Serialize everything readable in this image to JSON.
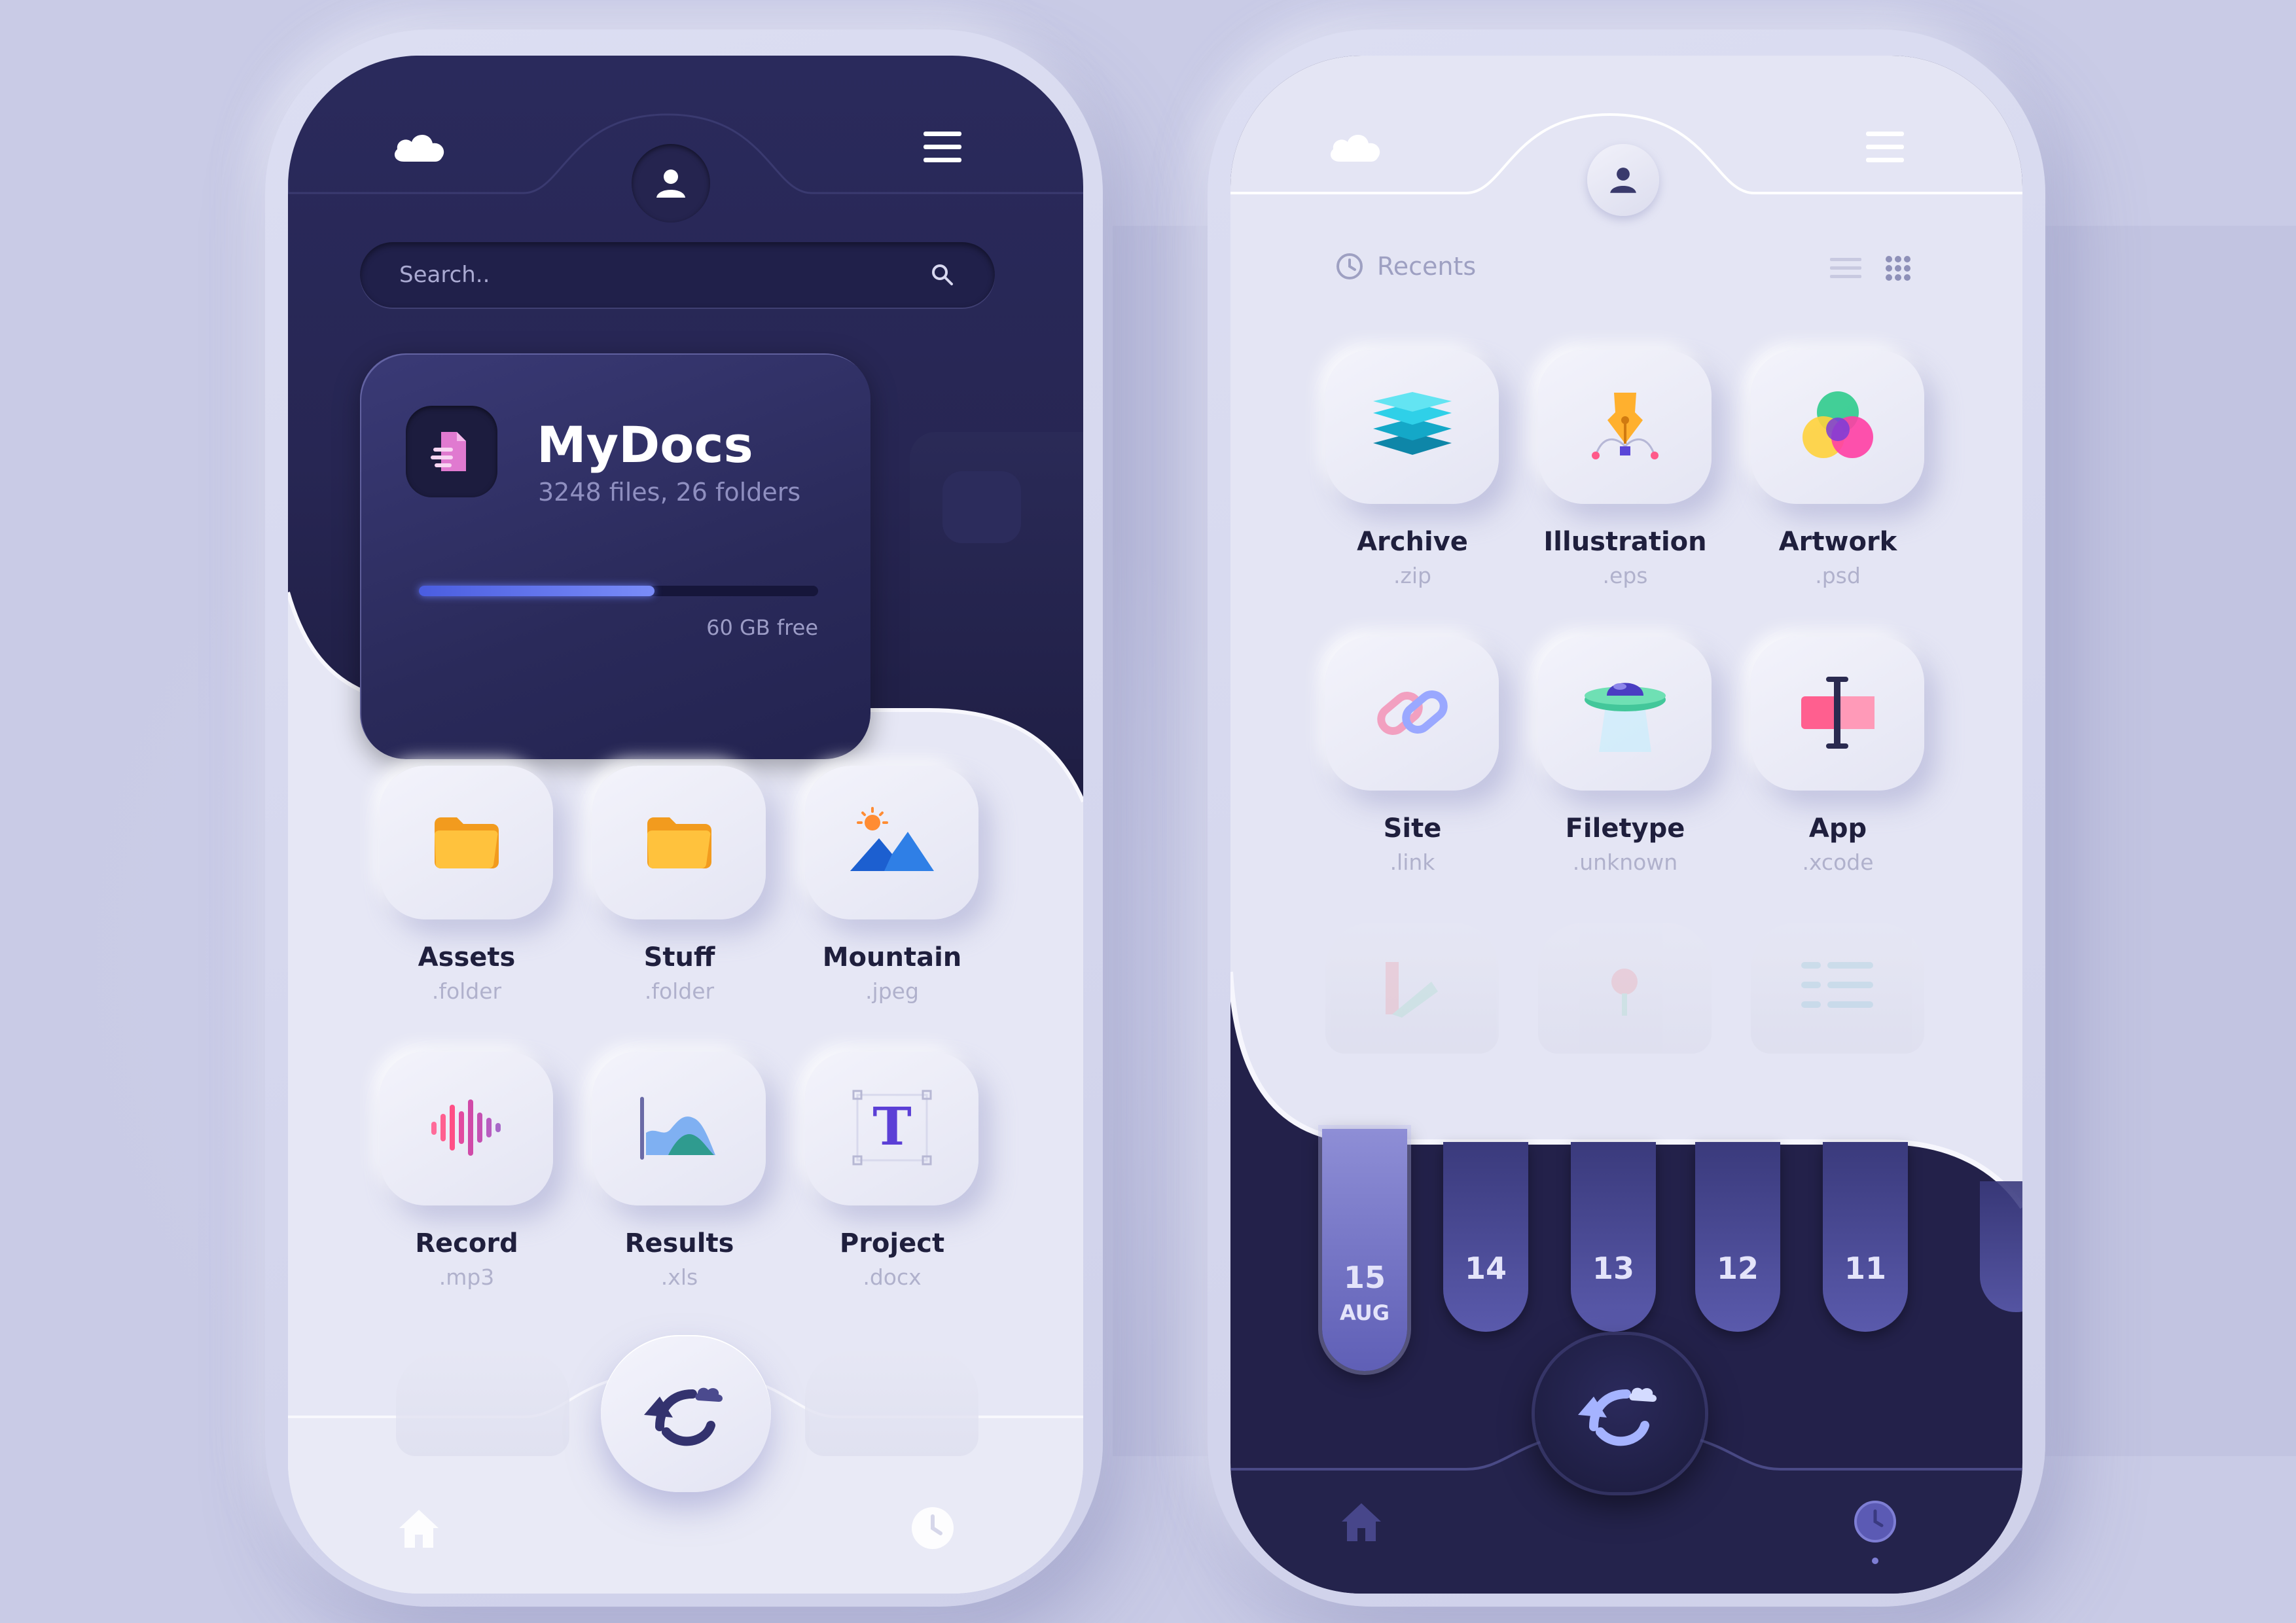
{
  "left_phone": {
    "search": {
      "placeholder": "Search.."
    },
    "drive_card": {
      "title": "MyDocs",
      "subtitle": "3248 files, 26 folders",
      "storage_used_fraction": 0.59,
      "free_label": "60 GB free"
    },
    "files": [
      {
        "name": "Assets",
        "ext": ".folder",
        "icon": "folder-icon"
      },
      {
        "name": "Stuff",
        "ext": ".folder",
        "icon": "folder-icon"
      },
      {
        "name": "Mountain",
        "ext": ".jpeg",
        "icon": "mountain-image-icon"
      },
      {
        "name": "Record",
        "ext": ".mp3",
        "icon": "soundwave-icon"
      },
      {
        "name": "Results",
        "ext": ".xls",
        "icon": "area-chart-icon"
      },
      {
        "name": "Project",
        "ext": ".docx",
        "icon": "text-document-icon"
      }
    ],
    "nav": {
      "home_icon": "home-icon",
      "upload_icon": "cloud-upload-icon",
      "recent_icon": "clock-icon"
    },
    "header": {
      "cloud_icon": "cloud-icon",
      "profile_icon": "user-icon",
      "menu_icon": "hamburger-menu-icon"
    }
  },
  "right_phone": {
    "section_title": "Recents",
    "files": [
      {
        "name": "Archive",
        "ext": ".zip",
        "icon": "layers-icon"
      },
      {
        "name": "Illustration",
        "ext": ".eps",
        "icon": "pen-tool-icon"
      },
      {
        "name": "Artwork",
        "ext": ".psd",
        "icon": "color-circles-icon"
      },
      {
        "name": "Site",
        "ext": ".link",
        "icon": "link-icon"
      },
      {
        "name": "Filetype",
        "ext": ".unknown",
        "icon": "ufo-icon"
      },
      {
        "name": "App",
        "ext": ".xcode",
        "icon": "text-cursor-icon"
      }
    ],
    "dates": [
      {
        "day": "15",
        "month": "AUG",
        "active": true
      },
      {
        "day": "14"
      },
      {
        "day": "13"
      },
      {
        "day": "12"
      },
      {
        "day": "11"
      }
    ],
    "nav": {
      "home_icon": "home-icon",
      "upload_icon": "cloud-upload-icon",
      "recent_icon": "clock-icon"
    }
  },
  "colors": {
    "background": "#c9cbe6",
    "dark_navy": "#272653",
    "light_surface": "#e6e7f5",
    "accent_blue": "#5b6cf0"
  }
}
